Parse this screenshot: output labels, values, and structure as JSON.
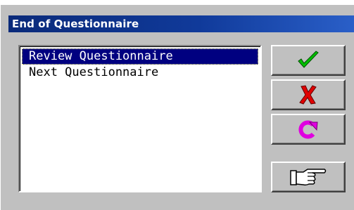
{
  "window": {
    "title": "End of Questionnaire"
  },
  "list": {
    "items": [
      {
        "label": "Review Questionnaire",
        "selected": true
      },
      {
        "label": "Next Questionnaire",
        "selected": false
      }
    ]
  },
  "buttons": [
    {
      "icon": "checkmark-icon",
      "color": "#00c000"
    },
    {
      "icon": "x-cross-icon",
      "color": "#e00000"
    },
    {
      "icon": "refresh-icon",
      "color": "#e000e0"
    },
    {
      "icon": "pointing-hand-icon",
      "color": "#ffffff"
    }
  ]
}
